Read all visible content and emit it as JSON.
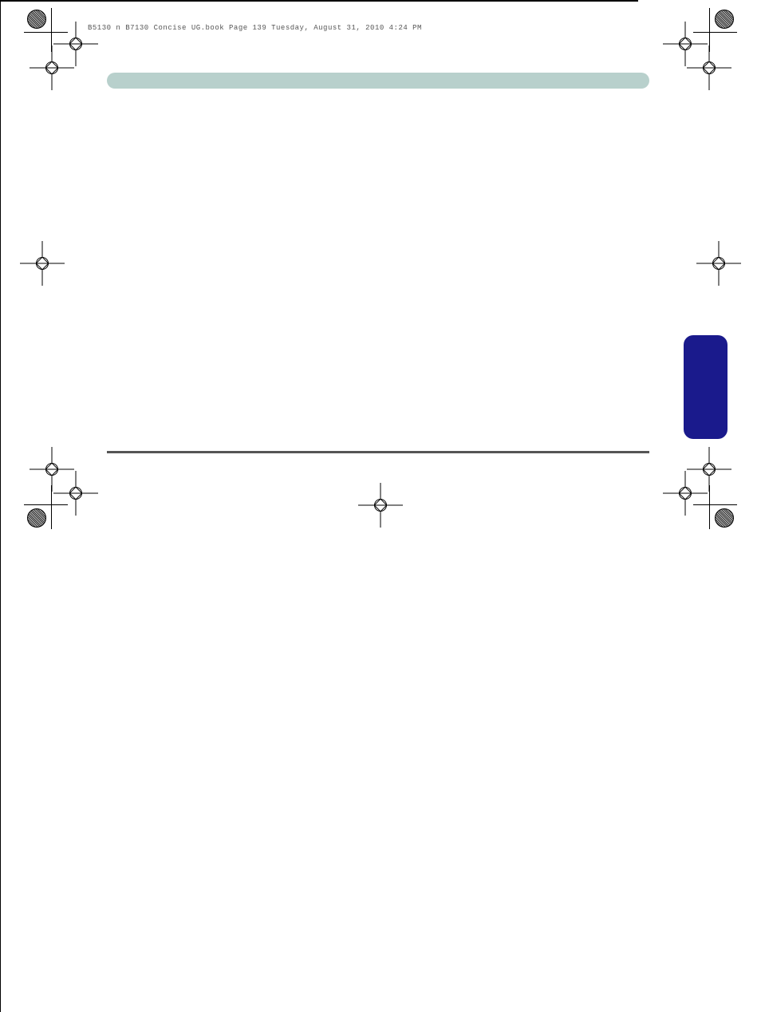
{
  "header": {
    "doc_info": "B5130 n B7130 Concise UG.book  Page 139  Tuesday, August 31, 2010  4:24 PM"
  },
  "colors": {
    "header_bar": "#b8d0cc",
    "side_tab": "#1a1a8c",
    "footer_line": "#555555"
  }
}
